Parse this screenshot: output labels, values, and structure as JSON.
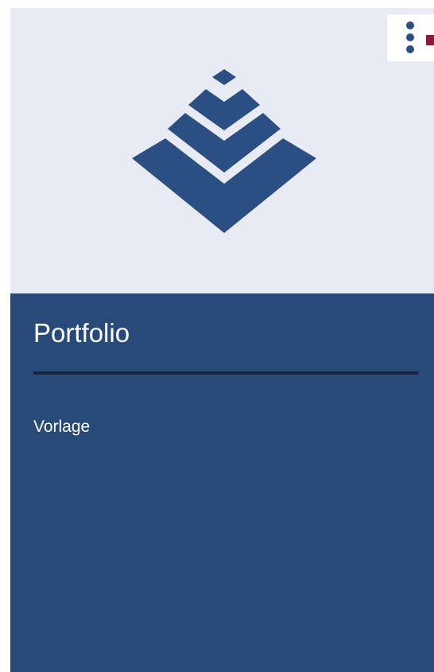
{
  "card": {
    "title": "Portfolio",
    "subtitle": "Vorlage",
    "logo_icon": "pyramid-chevrons-icon",
    "menu_icon": "kebab-menu-icon"
  },
  "colors": {
    "card_background": "#284a7b",
    "thumbnail_background": "#e8ebf4",
    "logo": "#2b4f82",
    "divider": "#17233f",
    "accent": "#8e1b3a",
    "text": "#ffffff"
  }
}
